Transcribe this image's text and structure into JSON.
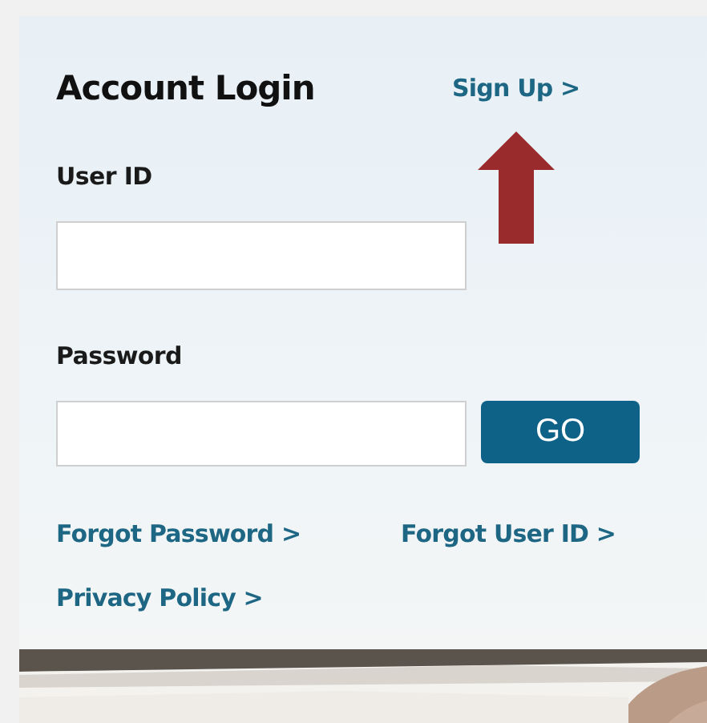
{
  "title": "Account Login",
  "sign_up_link": "Sign Up >",
  "fields": [
    {
      "label": "User ID"
    },
    {
      "label": "Password",
      "submit_button": "GO"
    }
  ],
  "links": [
    "Forgot Password >",
    "Forgot User ID >",
    "Privacy Policy >"
  ]
}
